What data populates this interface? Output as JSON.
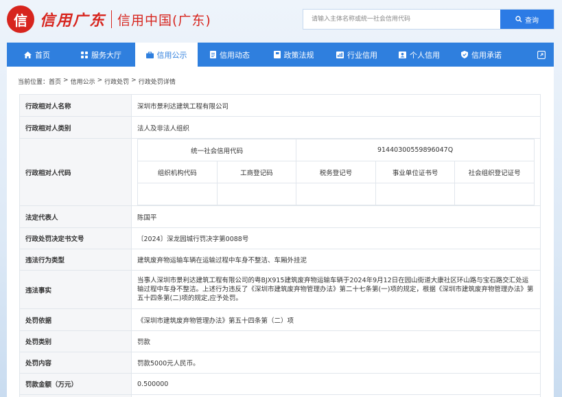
{
  "header": {
    "logo_char": "信",
    "brand": "信用广东",
    "site_name": "信用中国(广东)",
    "search_placeholder": "请输入主体名称或统一社会信用代码",
    "search_button": "查询"
  },
  "nav": {
    "items": [
      {
        "label": "首页",
        "icon": "home-icon"
      },
      {
        "label": "服务大厅",
        "icon": "grid-icon"
      },
      {
        "label": "信用公示",
        "icon": "bag-icon",
        "active": true
      },
      {
        "label": "信用动态",
        "icon": "document-icon"
      },
      {
        "label": "政策法规",
        "icon": "book-icon"
      },
      {
        "label": "行业信用",
        "icon": "chart-icon"
      },
      {
        "label": "个人信用",
        "icon": "person-card-icon"
      },
      {
        "label": "信用承诺",
        "icon": "shield-check-icon"
      }
    ],
    "external_icon": "external-link-icon"
  },
  "breadcrumb": {
    "prefix": "当前位置：",
    "items": [
      "首页",
      "信用公示",
      "行政处罚",
      "行政处罚详情"
    ],
    "separator": ">"
  },
  "detail": {
    "name_label": "行政相对人名称",
    "name_value": "深圳市景利达建筑工程有限公司",
    "type_label": "行政相对人类别",
    "type_value": "法人及非法人组织",
    "code_label": "行政相对人代码",
    "uscc_label": "统一社会信用代码",
    "uscc_value": "91440300559896047Q",
    "code_headers": [
      "组织机构代码",
      "工商登记码",
      "税务登记号",
      "事业单位证书号",
      "社会组织登记证号"
    ],
    "legal_rep_label": "法定代表人",
    "legal_rep_value": "陈国平",
    "doc_no_label": "行政处罚决定书文号",
    "doc_no_value": "〔2024〕深龙园城行罚决字第0088号",
    "violation_type_label": "违法行为类型",
    "violation_type_value": "建筑废弃物运输车辆在运输过程中车身不整洁、车厢外挂泥",
    "facts_label": "违法事实",
    "facts_value": "当事人深圳市景利达建筑工程有限公司的粤BJX915建筑废弃物运输车辆于2024年9月12日在园山街道大康社区环山路与宝石路交汇处运输过程中车身不整洁。上述行为违反了《深圳市建筑废弃物管理办法》第二十七条第(一)项的规定，根据《深圳市建筑废弃物管理办法》第五十四条第(二)项的规定,应予处罚。",
    "basis_label": "处罚依据",
    "basis_value": "《深圳市建筑废弃物管理办法》第五十四条第（二）项",
    "category_label": "处罚类别",
    "category_value": "罚款",
    "content_label": "处罚内容",
    "content_value": "罚款5000元人民币。",
    "amount_label": "罚款金额（万元）",
    "amount_value": "0.500000"
  },
  "colors": {
    "brand_red": "#d7251e",
    "nav_blue": "#2f7fde",
    "search_blue": "#2c7be5"
  }
}
